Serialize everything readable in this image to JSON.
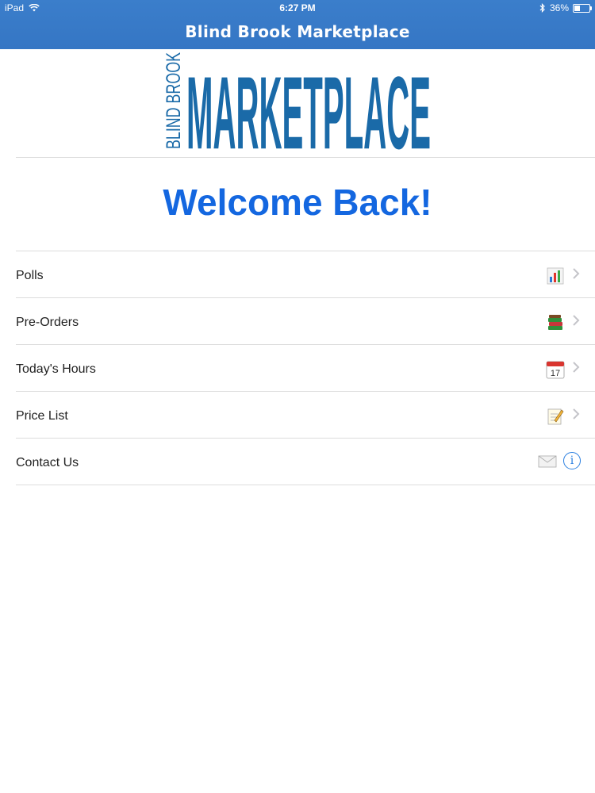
{
  "status": {
    "device": "iPad",
    "time": "6:27 PM",
    "battery": "36%"
  },
  "nav": {
    "title": "Blind Brook Marketplace"
  },
  "logo": {
    "side_text": "BLIND BROOK",
    "main_text": "MARKETPLACE",
    "color": "#1a6aa8"
  },
  "welcome": "Welcome Back!",
  "menu": [
    {
      "label": "Polls",
      "icon": "bar-chart-icon"
    },
    {
      "label": "Pre-Orders",
      "icon": "books-icon"
    },
    {
      "label": "Today's Hours",
      "icon": "calendar-icon",
      "calendar_day": "17"
    },
    {
      "label": "Price List",
      "icon": "notepad-pencil-icon"
    },
    {
      "label": "Contact Us",
      "icon": "envelope-icon",
      "accessory": "info"
    }
  ],
  "colors": {
    "nav_bar": "#3576c4",
    "welcome": "#1467e0",
    "info_accent": "#2a7fe0"
  }
}
